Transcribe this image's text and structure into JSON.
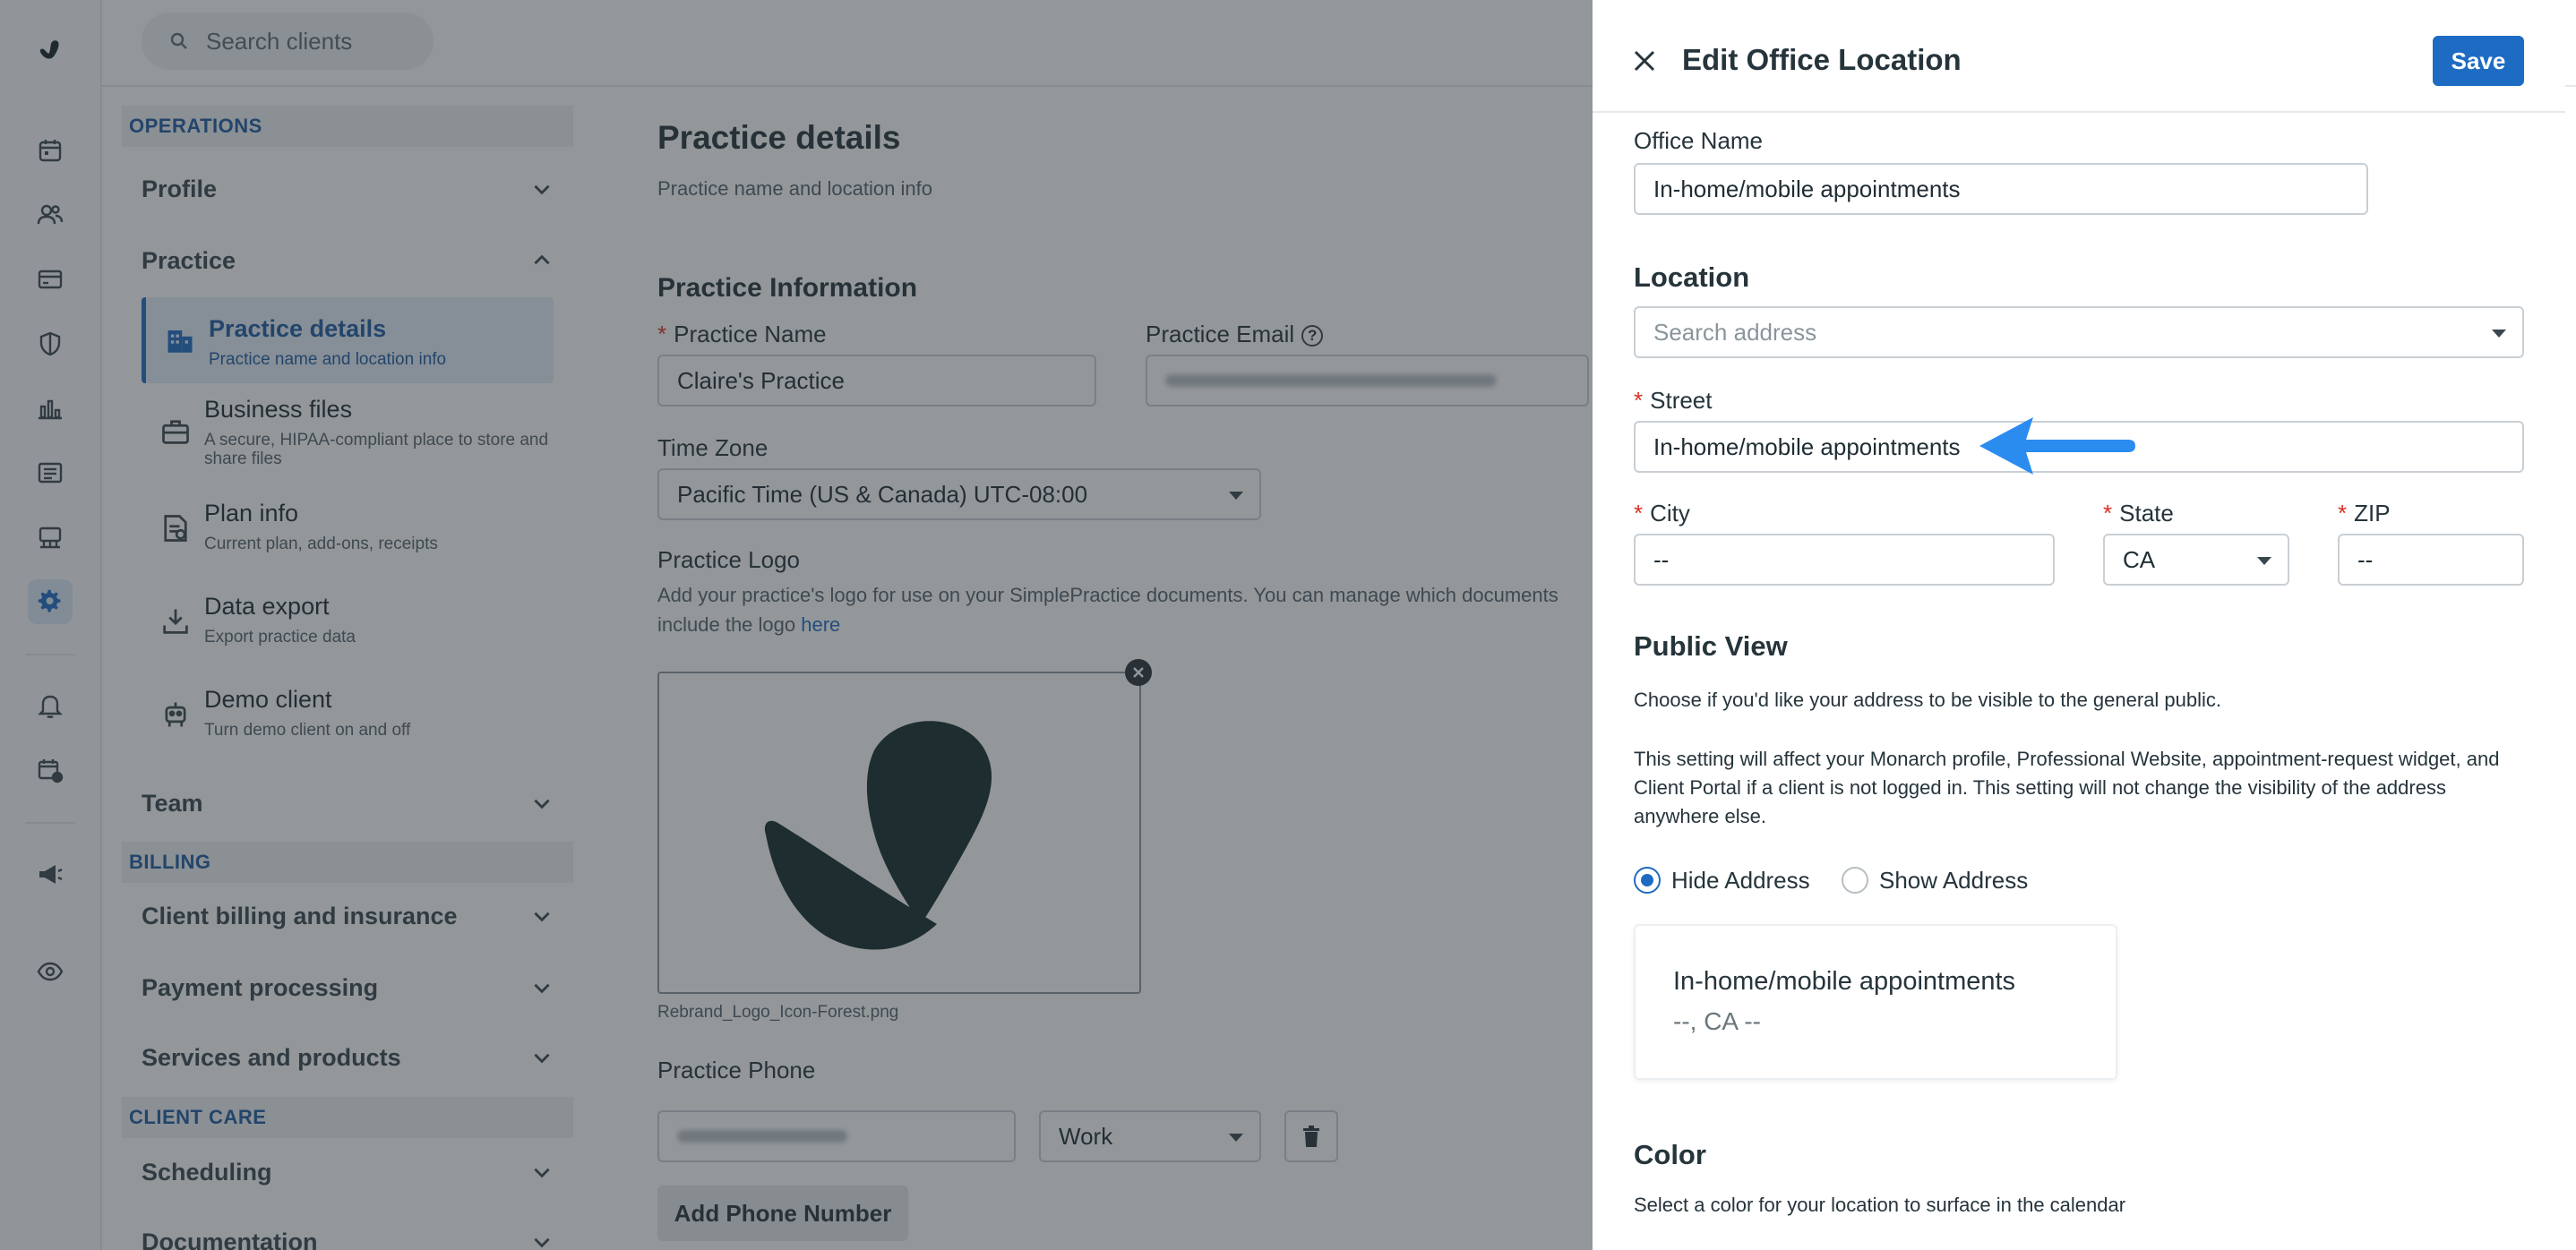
{
  "app": {
    "logo_icon": "simplepractice-logo-icon",
    "accent": "#1e6bc3"
  },
  "search": {
    "placeholder": "Search clients"
  },
  "rail": {
    "items": [
      {
        "icon": "calendar-icon"
      },
      {
        "icon": "clients-icon"
      },
      {
        "icon": "billing-card-icon"
      },
      {
        "icon": "insurance-shield-icon"
      },
      {
        "icon": "analytics-icon"
      },
      {
        "icon": "activity-list-icon"
      },
      {
        "icon": "marketplace-icon"
      },
      {
        "icon": "settings-gear-icon",
        "active": true
      },
      {
        "icon": "notifications-bell-icon"
      },
      {
        "icon": "requests-calendar-icon"
      },
      {
        "icon": "announcements-megaphone-icon"
      },
      {
        "icon": "preview-eye-icon"
      }
    ]
  },
  "sidebar": {
    "operations_label": "OPERATIONS",
    "profile_label": "Profile",
    "practice_label": "Practice",
    "practice_items": [
      {
        "title": "Practice details",
        "desc": "Practice name and location info",
        "icon": "building-icon"
      },
      {
        "title": "Business files",
        "desc": "A secure, HIPAA-compliant place to store and share files",
        "icon": "briefcase-icon"
      },
      {
        "title": "Plan info",
        "desc": "Current plan, add-ons, receipts",
        "icon": "plan-document-icon"
      },
      {
        "title": "Data export",
        "desc": "Export practice data",
        "icon": "download-tray-icon"
      },
      {
        "title": "Demo client",
        "desc": "Turn demo client on and off",
        "icon": "robot-icon"
      }
    ],
    "team_label": "Team",
    "billing_label": "BILLING",
    "billing_items": [
      "Client billing and insurance",
      "Payment processing",
      "Services and products"
    ],
    "client_care_label": "CLIENT CARE",
    "client_care_items": [
      "Scheduling",
      "Documentation"
    ]
  },
  "main": {
    "title": "Practice details",
    "subtitle": "Practice name and location info",
    "section_title": "Practice Information",
    "practice_name_label": "Practice Name",
    "practice_name_value": "Claire's Practice",
    "practice_email_label": "Practice Email",
    "time_zone_label": "Time Zone",
    "time_zone_value": "Pacific Time (US & Canada) UTC-08:00",
    "logo_label": "Practice Logo",
    "logo_desc": "Add your practice's logo for use on your SimplePractice documents. You can manage which documents include the logo",
    "logo_link": "here",
    "logo_filename": "Rebrand_Logo_Icon-Forest.png",
    "phone_label": "Practice Phone",
    "phone_type": "Work",
    "add_phone_label": "Add Phone Number"
  },
  "panel": {
    "title": "Edit Office Location",
    "save_label": "Save",
    "office_name_label": "Office Name",
    "office_name_value": "In-home/mobile appointments",
    "location_heading": "Location",
    "search_address_placeholder": "Search address",
    "street_label": "Street",
    "street_value": "In-home/mobile appointments",
    "city_label": "City",
    "city_value": "--",
    "state_label": "State",
    "state_value": "CA",
    "zip_label": "ZIP",
    "zip_value": "--",
    "public_view_heading": "Public View",
    "public_view_desc1": "Choose if you'd like your address to be visible to the general public.",
    "public_view_desc2": "This setting will affect your Monarch profile, Professional Website, appointment-request widget, and Client Portal if a client is not logged in. This setting will not change the visibility of the address anywhere else.",
    "hide_address_label": "Hide Address",
    "show_address_label": "Show Address",
    "selected_visibility": "Hide Address",
    "preview_line1": "In-home/mobile appointments",
    "preview_line2": "--, CA --",
    "color_heading": "Color",
    "color_desc": "Select a color for your location to surface in the calendar",
    "annotation_arrow_color": "#2b8cf0"
  }
}
